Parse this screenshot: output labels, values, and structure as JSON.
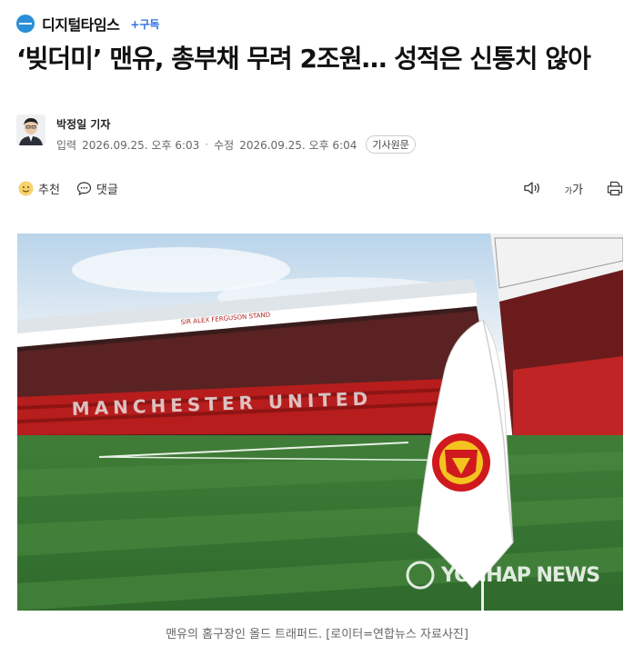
{
  "header": {
    "press_name": "디지털타임스",
    "subscribe_label": "+구독",
    "logo_icon": "digitaltimes-logo-icon",
    "accent_color": "#2a8fd8"
  },
  "article": {
    "title": "‘빚더미’ 맨유, 총부채 무려 2조원… 성적은 신통치 않아",
    "reporter": "박정일 기자",
    "published_label": "입력",
    "published": "2026.09.25. 오후 6:03",
    "modified_label": "수정",
    "modified": "2026.09.25. 오후 6:04",
    "original_button": "기사원문"
  },
  "actions": {
    "recommend": "추천",
    "comments": "댓글",
    "font_size": {
      "small": "가",
      "large": "가"
    },
    "icons": [
      "emoji-icon",
      "comment-icon",
      "speaker-icon",
      "font-size-icon",
      "print-icon"
    ]
  },
  "photo": {
    "stadium_sign": "SIR ALEX FERGUSON STAND",
    "stand_letters": "MANCHESTER UNITED",
    "watermark": "YONHAP NEWS",
    "caption": "맨유의 홈구장인 올드 트래퍼드. [로이터=연합뉴스 자료사진]"
  }
}
